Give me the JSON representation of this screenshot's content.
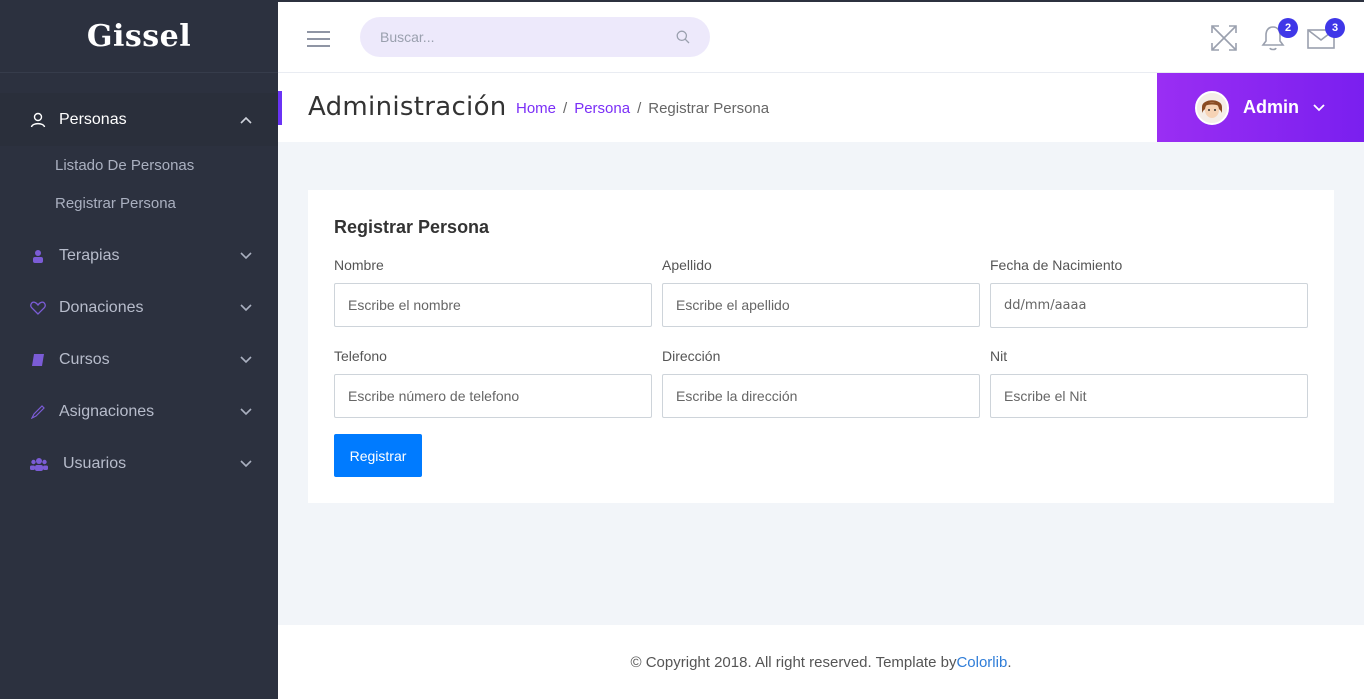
{
  "brand": {
    "logo": "Gissel"
  },
  "sidebar": {
    "items": [
      {
        "label": "Personas",
        "icon": "user-icon",
        "expanded": true,
        "children": [
          {
            "label": "Listado De Personas"
          },
          {
            "label": "Registrar Persona"
          }
        ]
      },
      {
        "label": "Terapias",
        "icon": "person-icon"
      },
      {
        "label": "Donaciones",
        "icon": "heart-icon"
      },
      {
        "label": "Cursos",
        "icon": "book-icon"
      },
      {
        "label": "Asignaciones",
        "icon": "pencil-icon"
      },
      {
        "label": "Usuarios",
        "icon": "users-icon"
      }
    ]
  },
  "header": {
    "search_placeholder": "Buscar...",
    "notifications_count": "2",
    "messages_count": "3"
  },
  "titlebar": {
    "title": "Administración",
    "breadcrumb": [
      "Home",
      "/",
      "Persona",
      "/",
      "Registrar Persona"
    ],
    "user_name": "Admin"
  },
  "form": {
    "title": "Registrar Persona",
    "fields": [
      {
        "label": "Nombre",
        "placeholder": "Escribe el nombre"
      },
      {
        "label": "Apellido",
        "placeholder": "Escribe el apellido"
      },
      {
        "label": "Fecha de Nacimiento",
        "placeholder": "dd/mm/aaaa"
      },
      {
        "label": "Telefono",
        "placeholder": "Escribe número de telefono"
      },
      {
        "label": "Dirección",
        "placeholder": "Escribe la dirección"
      },
      {
        "label": "Nit",
        "placeholder": "Escribe el Nit"
      }
    ],
    "submit_label": "Registrar"
  },
  "footer": {
    "text": "© Copyright 2018. All right reserved. Template by ",
    "link": "Colorlib",
    "suffix": "."
  },
  "colors": {
    "sidebar_bg": "#2c313f",
    "accent": "#7b2ff7",
    "primary_button": "#007bff",
    "badge": "#3f37e8"
  }
}
